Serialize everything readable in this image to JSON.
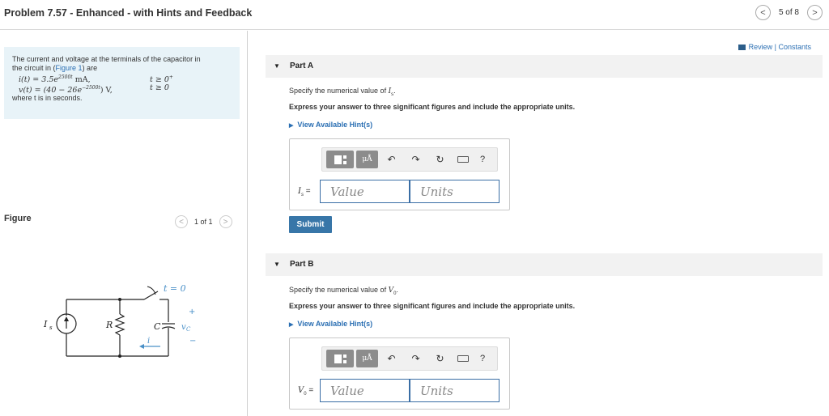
{
  "header": {
    "title": "Problem 7.57 - Enhanced - with Hints and Feedback",
    "pager_text": "5 of 8",
    "prev_glyph": "<",
    "next_glyph": ">"
  },
  "problem": {
    "intro_line1": "The current and voltage at the terminals of the capacitor in",
    "intro_line2_prefix": "the circuit in (",
    "figure_link": "Figure 1",
    "intro_line2_suffix": ") are",
    "eq1_lhs": "i(t) = 3.5e",
    "eq1_exp": "2500t",
    "eq1_unit": " mA,",
    "eq1_cond": "t ≥ 0",
    "eq1_cond_sup": "+",
    "eq2_lhs": "v(t) = (40 − 26e",
    "eq2_exp": "−2500t",
    "eq2_unit": ") V,",
    "eq2_cond": "t ≥ 0",
    "where_text": "where t is in seconds."
  },
  "figure": {
    "label": "Figure",
    "pager_text": "1 of 1",
    "prev_glyph": "<",
    "next_glyph": ">",
    "switch_label": "t = 0",
    "source_label": "I",
    "source_sub": "s",
    "resistor_label": "R",
    "capacitor_label": "C",
    "voltage_label": "v",
    "voltage_sub": "C",
    "plus": "+",
    "minus": "−",
    "current_label": "i"
  },
  "review": {
    "label": "Review | Constants"
  },
  "parts": [
    {
      "header": "Part A",
      "spec_prefix": "Specify the numerical value of ",
      "spec_var": "I",
      "spec_sub": "s",
      "spec_suffix": ".",
      "instruction": "Express your answer to three significant figures and include the appropriate units.",
      "hint": "View Available Hint(s)",
      "answer_var": "I",
      "answer_sub": "s",
      "answer_eq": " =",
      "value_placeholder": "Value",
      "units_placeholder": "Units",
      "submit_label": "Submit"
    },
    {
      "header": "Part B",
      "spec_prefix": "Specify the numerical value of ",
      "spec_var": "V",
      "spec_sub": "0",
      "spec_suffix": ".",
      "instruction": "Express your answer to three significant figures and include the appropriate units.",
      "hint": "View Available Hint(s)",
      "answer_var": "V",
      "answer_sub": "0",
      "answer_eq": " =",
      "value_placeholder": "Value",
      "units_placeholder": "Units"
    }
  ],
  "toolbar": {
    "units_glyph": "μÅ",
    "undo_glyph": "↶",
    "redo_glyph": "↷",
    "reset_glyph": "↻",
    "help_glyph": "?"
  },
  "colors": {
    "link": "#2b6fb3",
    "submit_bg": "#3876a8",
    "problem_bg": "#e8f3f8"
  }
}
